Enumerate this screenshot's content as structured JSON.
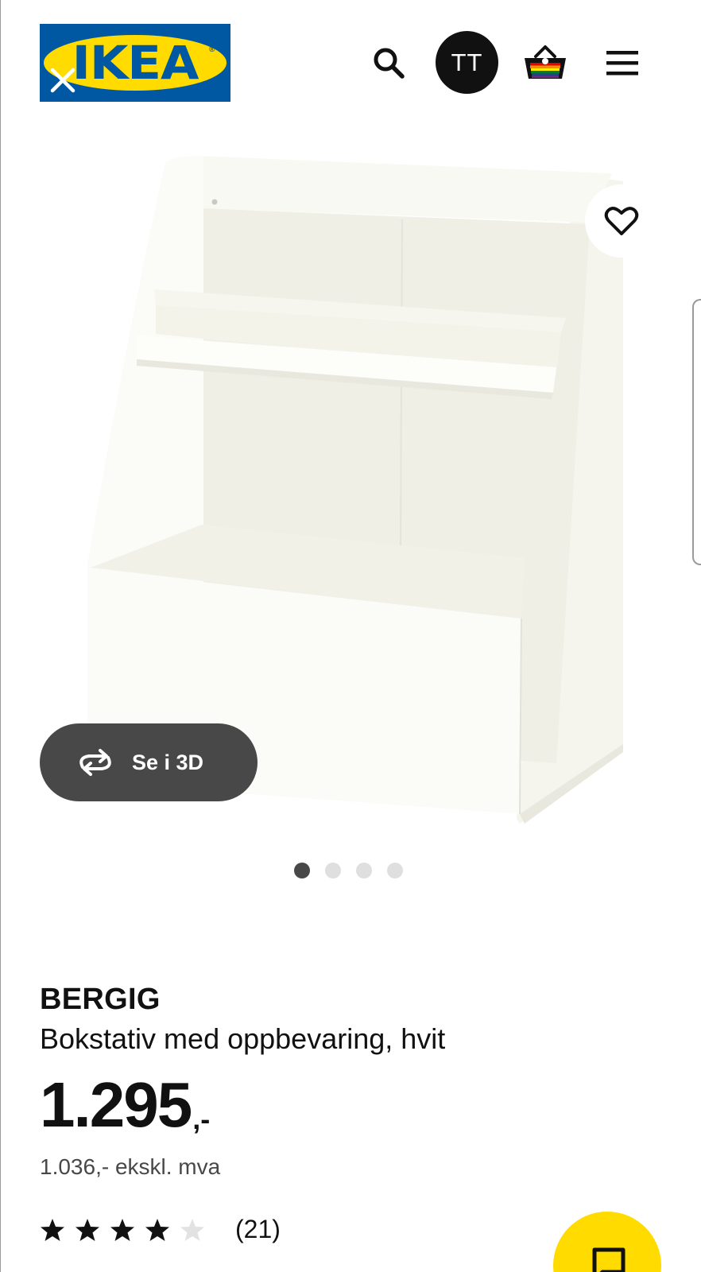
{
  "header": {
    "logo_text": "IKEA",
    "logo_registered": "®",
    "avatar_initials": "TT",
    "icons": [
      "close-icon",
      "search-icon",
      "basket-icon",
      "menu-icon"
    ]
  },
  "gallery": {
    "view_3d_label": "Se i 3D",
    "dot_count": 4,
    "active_dot": 1,
    "icons": [
      "heart-icon",
      "rotate-3d-icon"
    ]
  },
  "product": {
    "name": "BERGIG",
    "description": "Bokstativ med oppbevaring, hvit",
    "price": "1.295",
    "price_suffix": ",-",
    "price_ex_vat": "1.036,- ekskl. mva",
    "rating": 4,
    "rating_max": 5,
    "review_count": "(21)"
  },
  "colors": {
    "ikea_blue": "#0058a3",
    "ikea_yellow": "#ffdb00",
    "dark_gray": "#484848",
    "text": "#111111"
  }
}
